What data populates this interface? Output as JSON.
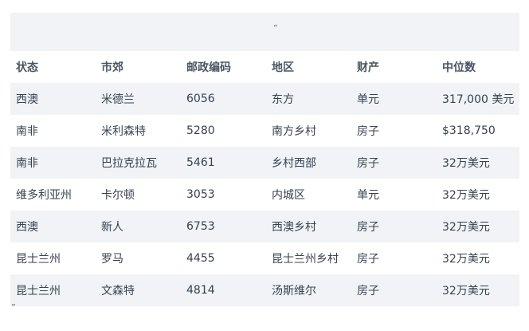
{
  "banner": {
    "mark": "”"
  },
  "table": {
    "headers": [
      "状态",
      "市郊",
      "邮政编码",
      "地区",
      "财产",
      "中位数"
    ],
    "rows": [
      [
        "西澳",
        "米德兰",
        "6056",
        "东方",
        "单元",
        "317,000 美元"
      ],
      [
        "南非",
        "米利森特",
        "5280",
        "南方乡村",
        "房子",
        "$318,750"
      ],
      [
        "南非",
        "巴拉克拉瓦",
        "5461",
        "乡村西部",
        "房子",
        "32万美元"
      ],
      [
        "维多利亚州",
        "卡尔顿",
        "3053",
        "内城区",
        "单元",
        "32万美元"
      ],
      [
        "西澳",
        "新人",
        "6753",
        "西澳乡村",
        "房子",
        "32万美元"
      ],
      [
        "昆士兰州",
        "罗马",
        "4455",
        "昆士兰州乡村",
        "房子",
        "32万美元"
      ],
      [
        "昆士兰州",
        "文森特",
        "4814",
        "汤斯维尔",
        "房子",
        "32万美元"
      ]
    ]
  },
  "footer": {
    "mark": "”"
  }
}
